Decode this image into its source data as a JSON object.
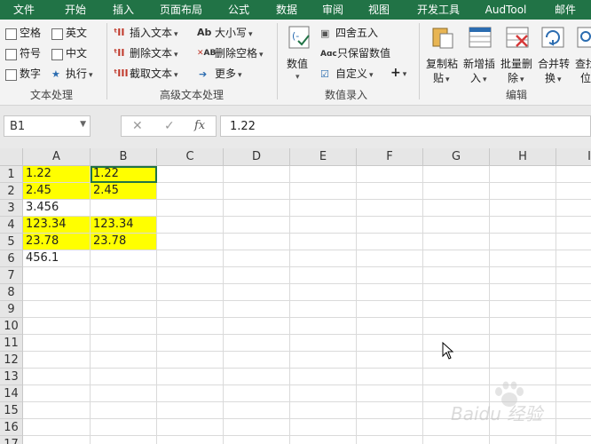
{
  "tabs": [
    "文件",
    "开始",
    "插入",
    "页面布局",
    "公式",
    "数据",
    "审阅",
    "视图",
    "开发工具",
    "AudTool",
    "邮件"
  ],
  "ribbon": {
    "text_group": {
      "label": "文本处理",
      "items": [
        "空格",
        "英文",
        "符号",
        "中文",
        "数字",
        "执行"
      ]
    },
    "advanced_group": {
      "label": "高级文本处理",
      "insert_text": "插入文本",
      "delete_text": "删除文本",
      "extract_text": "截取文本",
      "case": "大小写",
      "delete_spaces": "删除空格",
      "more": "更多"
    },
    "numeric_group": {
      "label": "数值录入",
      "number": "数值",
      "round": "四舍五入",
      "keep_value": "只保留数值",
      "custom": "自定义",
      "plus": "+"
    },
    "edit_group": {
      "label": "编辑",
      "copy_paste": [
        "复制粘",
        "贴"
      ],
      "insert": [
        "新增插",
        "入"
      ],
      "batch_delete": [
        "批量删",
        "除"
      ],
      "merge": [
        "合并转",
        "换"
      ],
      "find": [
        "查找",
        "位"
      ]
    }
  },
  "formula_bar": {
    "name_box": "B1",
    "cancel": "✕",
    "confirm": "✓",
    "fx": "fx",
    "value": "1.22"
  },
  "columns": [
    "A",
    "B",
    "C",
    "D",
    "E",
    "F",
    "G",
    "H",
    "I"
  ],
  "rows": [
    "1",
    "2",
    "3",
    "4",
    "5",
    "6",
    "7",
    "8",
    "9",
    "10",
    "11",
    "12",
    "13",
    "14",
    "15",
    "16",
    "17"
  ],
  "cells": {
    "A1": "1.22",
    "B1": "1.22",
    "A2": "2.45",
    "B2": "2.45",
    "A3": "3.456",
    "A4": "123.34",
    "B4": "123.34",
    "A5": "23.78",
    "B5": "23.78",
    "A6": "456.1"
  },
  "colors": {
    "accent": "#217346",
    "highlight": "#ffff00"
  },
  "watermark": "Baidu 经验"
}
